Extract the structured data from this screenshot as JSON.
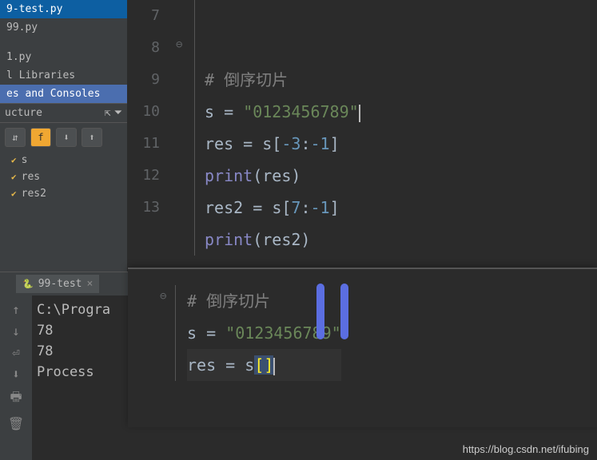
{
  "sidebar": {
    "files": [
      {
        "name": "9-test.py",
        "selected": true
      },
      {
        "name": "99.py",
        "selected": false
      },
      {
        "name": "1.py",
        "selected": false
      }
    ],
    "libs": "l Libraries",
    "consoles": "es and Consoles",
    "structure": "ucture",
    "vars": [
      {
        "name": "s"
      },
      {
        "name": "res"
      },
      {
        "name": "res2"
      }
    ]
  },
  "tab": {
    "name": "99-test",
    "close": "×"
  },
  "console": {
    "lines": [
      "C:\\Progra",
      "78",
      "78",
      "",
      "Process "
    ]
  },
  "editor": {
    "line_numbers": [
      "7",
      "8",
      "9",
      "10",
      "11",
      "12",
      "13"
    ],
    "code": {
      "l7": "",
      "l8_comment": "# 倒序切片",
      "l9_a": "s ",
      "l9_eq": "= ",
      "l9_str": "\"0123456789\"",
      "l10_a": "res ",
      "l10_eq": "= ",
      "l10_b": "s[",
      "l10_n1": "-3",
      "l10_c": ":",
      "l10_n2": "-1",
      "l10_d": "]",
      "l11_fn": "print",
      "l11_a": "(res)",
      "l12_a": "res2 ",
      "l12_eq": "= ",
      "l12_b": "s[",
      "l12_n1": "7",
      "l12_c": ":",
      "l12_n2": "-1",
      "l12_d": "]",
      "l13_fn": "print",
      "l13_a": "(res2)"
    }
  },
  "editor2": {
    "code": {
      "l1_comment": "# 倒序切片",
      "l2_a": "s ",
      "l2_eq": "= ",
      "l2_str": "\"0123456789\"",
      "l3_a": "res ",
      "l3_eq": "= ",
      "l3_b": "s",
      "l3_br1": "[",
      "l3_br2": "]"
    }
  },
  "watermark": "https://blog.csdn.net/ifubing"
}
